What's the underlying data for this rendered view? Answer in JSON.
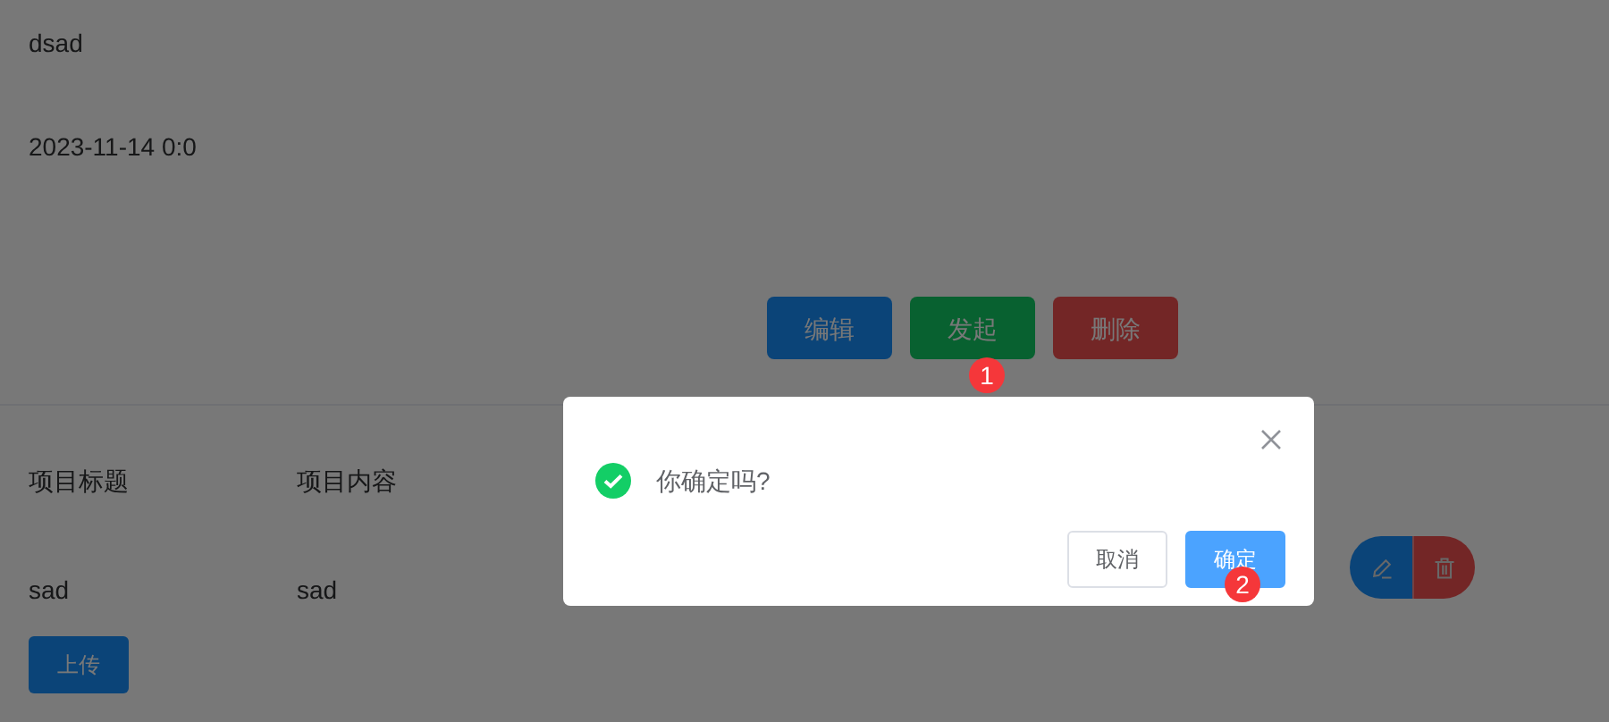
{
  "detail": {
    "fields": [
      {
        "value": "dsad"
      },
      {
        "value": "2023-11-14 0:0"
      }
    ],
    "actions": [
      {
        "label": "编辑",
        "kind": "primary"
      },
      {
        "label": "发起",
        "kind": "success"
      },
      {
        "label": "删除",
        "kind": "danger"
      }
    ]
  },
  "table": {
    "columns": [
      "项目标题",
      "项目内容"
    ],
    "rows": [
      {
        "cells": [
          "sad",
          "sad"
        ],
        "upload": "上传"
      }
    ]
  },
  "dialog": {
    "message": "你确定吗?",
    "buttons": [
      {
        "label": "取消",
        "kind": "default"
      },
      {
        "label": "确定",
        "kind": "primary"
      }
    ]
  },
  "step_markers": [
    "1",
    "2"
  ]
}
